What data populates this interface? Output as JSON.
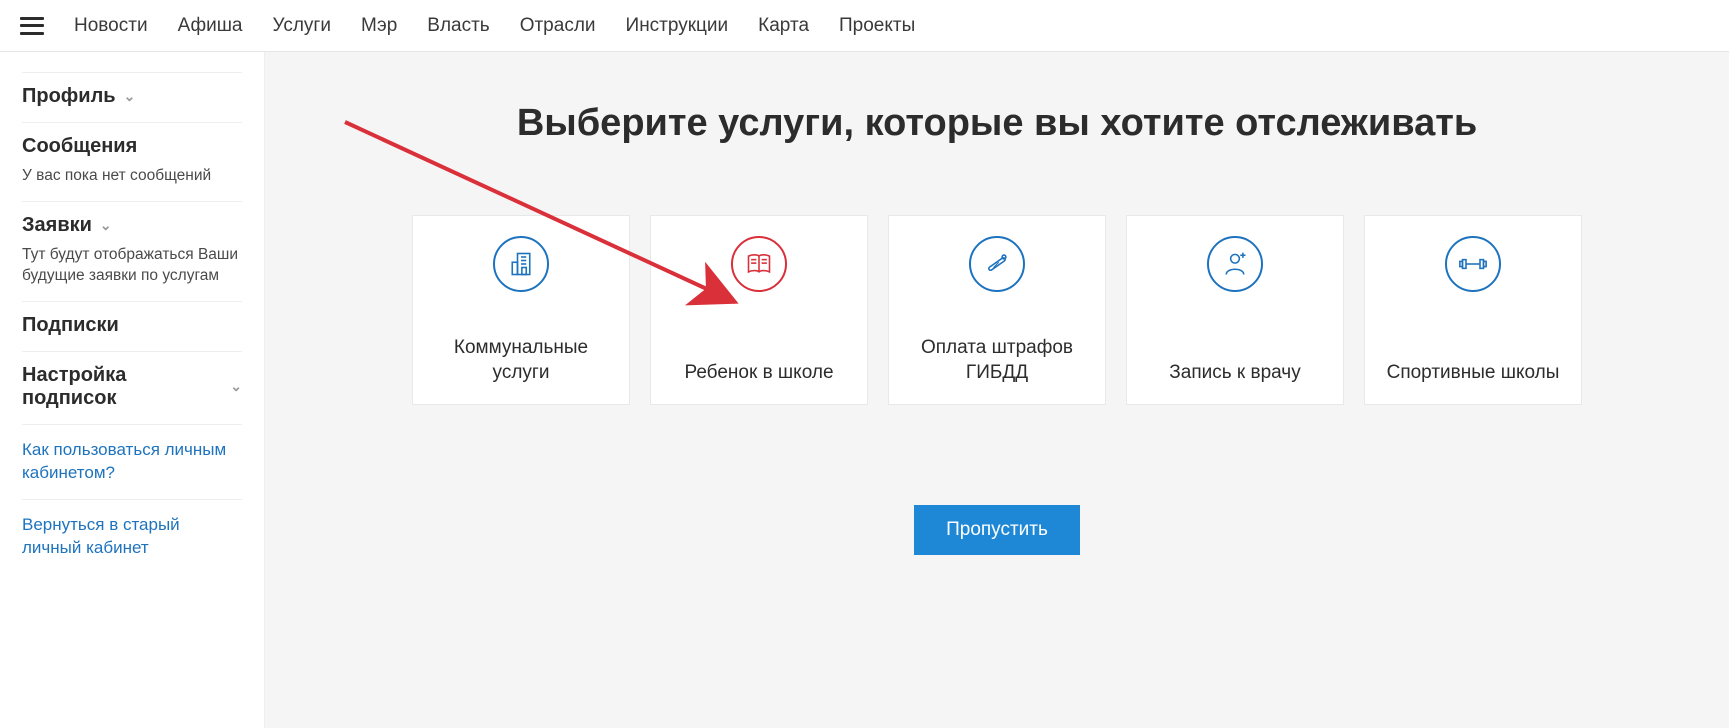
{
  "topnav": {
    "items": [
      "Новости",
      "Афиша",
      "Услуги",
      "Мэр",
      "Власть",
      "Отрасли",
      "Инструкции",
      "Карта",
      "Проекты"
    ]
  },
  "sidebar": {
    "profile": {
      "title": "Профиль"
    },
    "messages": {
      "title": "Сообщения",
      "desc": "У вас пока нет сообщений"
    },
    "requests": {
      "title": "Заявки",
      "desc": "Тут будут отображаться Ваши будущие заявки по услугам"
    },
    "subscriptions": {
      "title": "Подписки"
    },
    "subsettings": {
      "title": "Настройка подписок"
    },
    "link_help": "Как пользоваться личным кабинетом?",
    "link_old": "Вернуться в старый личный кабинет"
  },
  "main": {
    "heading": "Выберите услуги, которые вы хотите отслеживать",
    "cards": [
      {
        "label": "Коммунальные услуги",
        "icon": "building-icon",
        "accent": "blue"
      },
      {
        "label": "Ребенок в школе",
        "icon": "book-icon",
        "accent": "red"
      },
      {
        "label": "Оплата штрафов ГИБДД",
        "icon": "baton-icon",
        "accent": "blue"
      },
      {
        "label": "Запись к врачу",
        "icon": "doctor-icon",
        "accent": "blue"
      },
      {
        "label": "Спортивные школы",
        "icon": "dumbbell-icon",
        "accent": "blue"
      }
    ],
    "skip_label": "Пропустить"
  }
}
